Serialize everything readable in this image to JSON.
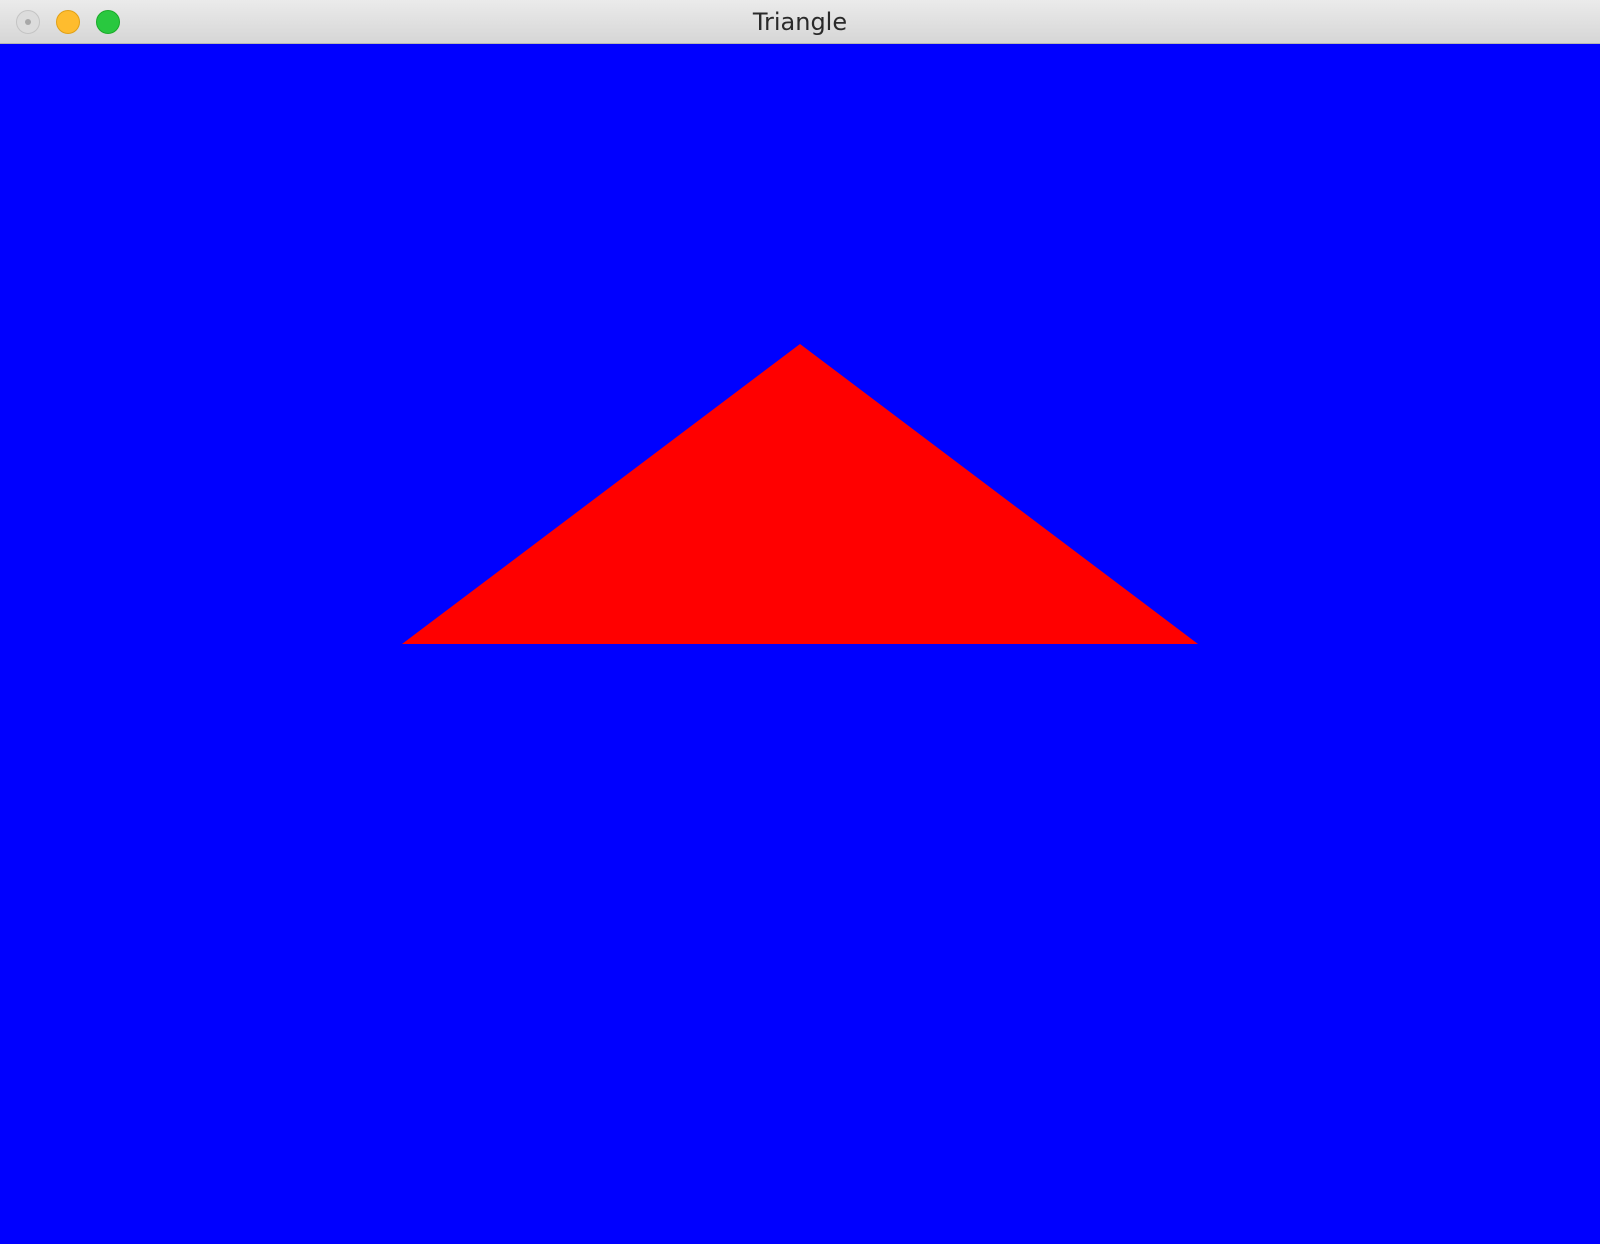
{
  "window": {
    "title": "Triangle",
    "controls": {
      "close": "close-icon",
      "minimize": "minimize-icon",
      "zoom": "zoom-icon"
    }
  },
  "scene": {
    "background_color": "#0000ff",
    "triangle_color": "#ff0000"
  }
}
